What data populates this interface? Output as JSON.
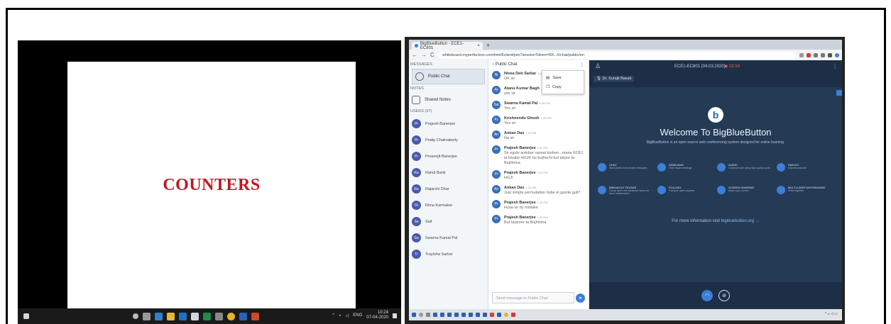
{
  "left_panel": {
    "slide_title": "COUNTERS",
    "taskbar": {
      "lang": "ENG",
      "time": "10:24",
      "date": "07-04-2020"
    }
  },
  "browser": {
    "tab_title": "BigBlueButton - ECE1-EC801",
    "url": "whiteboard.myperfection.com/html5client/join?sessionToken=00f...#/chat/public/en"
  },
  "sidebar": {
    "messages_header": "MESSAGES",
    "public_chat": "Public Chat",
    "notes_header": "NOTES",
    "shared_notes": "Shared Notes",
    "users_header": "USERS (37)",
    "users": [
      {
        "initials": "Pr",
        "name": "Prajesh Banerjee"
      },
      {
        "initials": "Pr",
        "name": "Pratip Chakraborty"
      },
      {
        "initials": "Pr",
        "name": "Prosenjit Banerjee"
      },
      {
        "initials": "Ra",
        "name": "Rahul Barik"
      },
      {
        "initials": "Ra",
        "name": "Rajarshi Dhar"
      },
      {
        "initials": "Ri",
        "name": "Rima Karmakar"
      },
      {
        "initials": "Sa",
        "name": "Saif"
      },
      {
        "initials": "Sw",
        "name": "Swarna Kamal Pal"
      },
      {
        "initials": "Tr",
        "name": "Trayisha Sarkar"
      }
    ]
  },
  "chat": {
    "header": "Public Chat",
    "input_placeholder": "Send message to Public Chat",
    "context_menu": [
      "Save",
      "Copy"
    ],
    "messages": [
      {
        "initials": "Ni",
        "name": "Nivea Deb Sarkar",
        "time": "1:20 PM",
        "text": "OK sir"
      },
      {
        "initials": "At",
        "name": "Atanu Kumar Bagh",
        "time": "1:20 PM",
        "text": "yes sir"
      },
      {
        "initials": "Sw",
        "name": "Swarna Kamal Pal",
        "time": "1:20 PM",
        "text": "Yes sir"
      },
      {
        "initials": "Kr",
        "name": "Krishnendu Ghosh",
        "time": "1:20 PM",
        "text": "Yes sir"
      },
      {
        "initials": "An",
        "name": "Ankan Das",
        "time": "1:20 PM",
        "text": "Ha sir"
      },
      {
        "initials": "Pr",
        "name": "Prajesh Banerjee",
        "time": "1:22 PM",
        "text": "Sir egulo arekbar repeat korben.. mane ECE1 ta kivabe HGJK ho bujhechi but tarpor ta Bujhinina"
      },
      {
        "initials": "Pr",
        "name": "Prajesh Banerjee",
        "time": "1:22 PM",
        "text": "HGJI"
      },
      {
        "initials": "An",
        "name": "Ankan Das",
        "time": "1:22 PM",
        "text": "Just simple permutation hobe ei gulote guli?"
      },
      {
        "initials": "Pr",
        "name": "Prajesh Banerjee",
        "time": "1:22 PM",
        "text": "Hyaa sir by mistake"
      },
      {
        "initials": "Pr",
        "name": "Prajesh Banerjee",
        "time": "1:23 PM",
        "text": "But tarporer ta Bujhinina"
      }
    ]
  },
  "meeting": {
    "title": "ECE1-EC801 (04.03.2020)",
    "recording_time": "22:16",
    "presenter": "Dr. Surajit Basak",
    "welcome_title": "Welcome To BigBlueButton",
    "welcome_sub": "BigBlueButton is an open source web conferencing system designed for online learning.",
    "features": [
      {
        "title": "Chat",
        "desc": "Send public and private messages"
      },
      {
        "title": "Webcams",
        "desc": "Hold visual meetings"
      },
      {
        "title": "Audio",
        "desc": "Communicate using high quality audio"
      },
      {
        "title": "Emojis",
        "desc": "Express yourself"
      },
      {
        "title": "Breakout Rooms",
        "desc": "Group users into breakout rooms for team collaboration"
      },
      {
        "title": "Polling",
        "desc": "Poll your users anytime"
      },
      {
        "title": "Screen Sharing",
        "desc": "Share your screen"
      },
      {
        "title": "Multi-User Whiteboard",
        "desc": "Draw together"
      }
    ],
    "more_info_prefix": "For more information visit",
    "more_info_link": "bigbluebutton.org →"
  },
  "colors": {
    "slide_title": "#c0181f",
    "bbb_dark": "#1c2f47",
    "bbb_blue": "#3d7fd6"
  }
}
